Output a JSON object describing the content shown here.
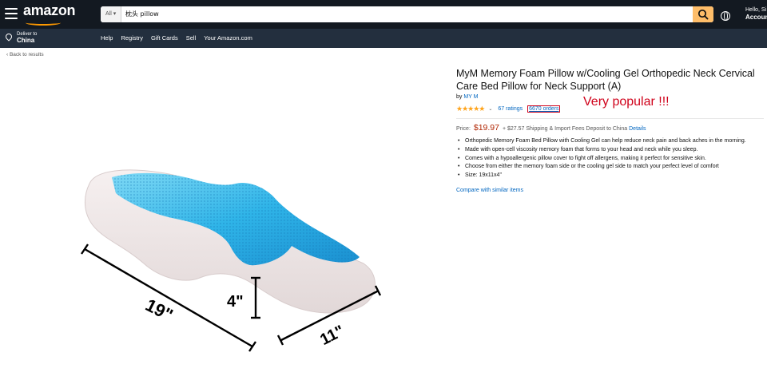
{
  "nav": {
    "logo": "amazon",
    "search_category": "All ▾",
    "search_value": "枕头 pillow",
    "account_greeting": "Hello, Si",
    "account_label": "Accoun",
    "deliver_label": "Deliver to",
    "deliver_location": "China",
    "links": [
      "Help",
      "Registry",
      "Gift Cards",
      "Sell",
      "Your Amazon.com"
    ]
  },
  "breadcrumb": "‹ Back to results",
  "product": {
    "title": "MyM Memory Foam Pillow w/Cooling Gel Orthopedic Neck Cervical Care Bed Pillow for Neck Support (A)",
    "by": "by",
    "brand": "MY M",
    "stars": "★★★★★",
    "chevron": "⌄",
    "ratings": "67 ratings",
    "orders": "6670 orders",
    "annotation": "Very popular !!!",
    "price_label": "Price:",
    "price": "$19.97",
    "shipping": "+ $27.57 Shipping & Import Fees Deposit to China",
    "details_link": "Details",
    "bullets": [
      "Orthopedic Memory Foam Bed Pillow with Cooling Gel can help reduce neck pain and back aches in the morning.",
      "Made with open-cell viscosity memory foam that forms to your head and neck while you sleep.",
      "Comes with a hypoallergenic pillow cover to fight off allergens, making it perfect for sensitive skin.",
      "Choose from either the memory foam side or the cooling gel side to match your perfect level of comfort",
      "Size: 19x11x4\""
    ],
    "compare_link": "Compare with similar items"
  },
  "image": {
    "dim_length": "19\"",
    "dim_height": "4\"",
    "dim_width": "11\""
  },
  "colors": {
    "nav_dark": "#131921",
    "nav_light": "#232f3e",
    "accent": "#febd69",
    "link": "#0066c0",
    "price": "#b12704",
    "annotation": "#d0021b",
    "star": "#ffa41c"
  }
}
